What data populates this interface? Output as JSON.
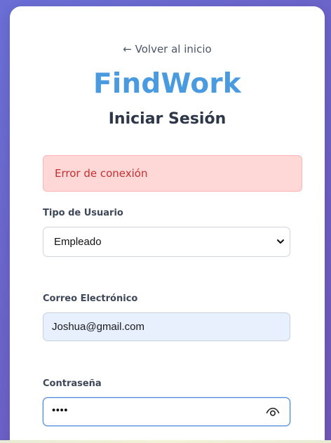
{
  "nav": {
    "back_link": "← Volver al inicio"
  },
  "brand": {
    "name": "FindWork",
    "color": "#4a9ae0"
  },
  "page": {
    "title": "Iniciar Sesión"
  },
  "alert": {
    "message": "Error de conexión",
    "type": "error"
  },
  "form": {
    "user_type": {
      "label": "Tipo de Usuario",
      "selected": "Empleado"
    },
    "email": {
      "label": "Correo Electrónico",
      "value": "Joshua@gmail.com"
    },
    "password": {
      "label": "Contraseña",
      "masked_value": "••••",
      "toggle_icon": "eye-icon"
    }
  }
}
